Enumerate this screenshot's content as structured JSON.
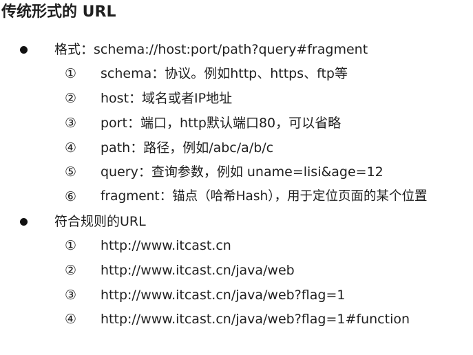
{
  "title": "传统形式的 URL",
  "bullet_icon": "filled-circle",
  "sections": [
    {
      "text": "格式：schema://host:port/path?query#fragment",
      "items": [
        {
          "num": "①",
          "text": "schema：协议。例如http、https、ftp等"
        },
        {
          "num": "②",
          "text": "host：域名或者IP地址"
        },
        {
          "num": "③",
          "text": "port：端口，http默认端口80，可以省略"
        },
        {
          "num": "④",
          "text": "path：路径，例如/abc/a/b/c"
        },
        {
          "num": "⑤",
          "text": "query：查询参数，例如 uname=lisi&age=12"
        },
        {
          "num": "⑥",
          "text": "fragment：锚点（哈希Hash），用于定位页面的某个位置"
        }
      ]
    },
    {
      "text": "符合规则的URL",
      "items": [
        {
          "num": "①",
          "text": "http://www.itcast.cn"
        },
        {
          "num": "②",
          "text": "http://www.itcast.cn/java/web"
        },
        {
          "num": "③",
          "text": "http://www.itcast.cn/java/web?flag=1"
        },
        {
          "num": "④",
          "text": "http://www.itcast.cn/java/web?flag=1#function"
        }
      ]
    }
  ]
}
